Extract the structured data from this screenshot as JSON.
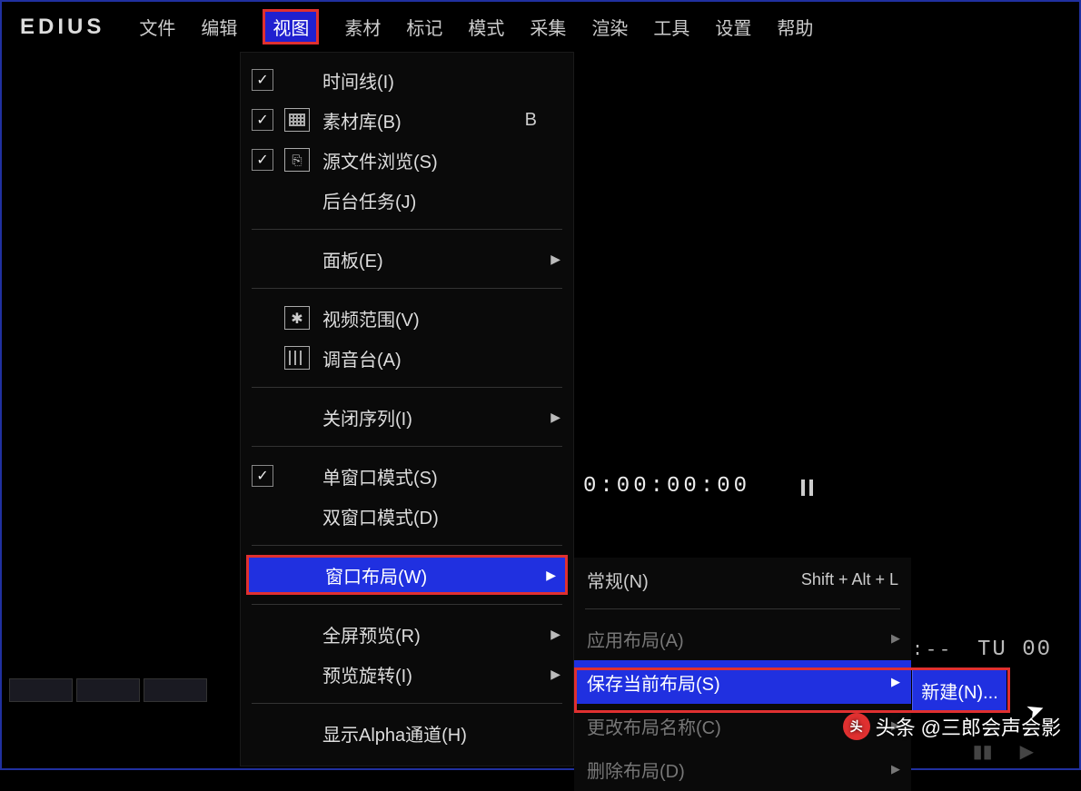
{
  "app": {
    "logo": "EDIUS"
  },
  "menubar": {
    "items": [
      "文件",
      "编辑",
      "视图",
      "素材",
      "标记",
      "模式",
      "采集",
      "渲染",
      "工具",
      "设置",
      "帮助"
    ],
    "active_index": 2
  },
  "dropdown": {
    "items": [
      {
        "checked": true,
        "icon": "",
        "label": "时间线(I)",
        "shortcut": "",
        "submenu": false
      },
      {
        "checked": true,
        "icon": "grid",
        "label": "素材库(B)",
        "shortcut": "B",
        "submenu": false
      },
      {
        "checked": true,
        "icon": "usb",
        "label": "源文件浏览(S)",
        "shortcut": "",
        "submenu": false
      },
      {
        "checked": false,
        "icon": "",
        "label": "后台任务(J)",
        "shortcut": "",
        "submenu": false
      },
      {
        "sep": true
      },
      {
        "checked": false,
        "icon": "",
        "label": "面板(E)",
        "shortcut": "",
        "submenu": true
      },
      {
        "sep": true
      },
      {
        "checked": false,
        "icon": "fan",
        "label": "视频范围(V)",
        "shortcut": "",
        "submenu": false
      },
      {
        "checked": false,
        "icon": "mixer",
        "label": "调音台(A)",
        "shortcut": "",
        "submenu": false
      },
      {
        "sep": true
      },
      {
        "checked": false,
        "icon": "",
        "label": "关闭序列(I)",
        "shortcut": "",
        "submenu": true
      },
      {
        "sep": true
      },
      {
        "checked": true,
        "icon": "",
        "label": "单窗口模式(S)",
        "shortcut": "",
        "submenu": false
      },
      {
        "checked": false,
        "icon": "",
        "label": "双窗口模式(D)",
        "shortcut": "",
        "submenu": false
      },
      {
        "sep": true
      },
      {
        "checked": false,
        "icon": "",
        "label": "窗口布局(W)",
        "shortcut": "",
        "submenu": true,
        "selected": true
      },
      {
        "sep": true
      },
      {
        "checked": false,
        "icon": "",
        "label": "全屏预览(R)",
        "shortcut": "",
        "submenu": true
      },
      {
        "checked": false,
        "icon": "",
        "label": "预览旋转(I)",
        "shortcut": "",
        "submenu": true
      },
      {
        "sep": true
      },
      {
        "checked": false,
        "icon": "",
        "label": "显示Alpha通道(H)",
        "shortcut": "",
        "submenu": false
      }
    ]
  },
  "submenu": {
    "items": [
      {
        "label": "常规(N)",
        "shortcut": "Shift + Alt + L",
        "submenu": false
      },
      {
        "sep": true
      },
      {
        "label": "应用布局(A)",
        "shortcut": "",
        "submenu": true,
        "dim": true
      },
      {
        "label": "保存当前布局(S)",
        "shortcut": "",
        "submenu": true,
        "selected": true
      },
      {
        "label": "更改布局名称(C)",
        "shortcut": "",
        "submenu": true,
        "dim": true
      },
      {
        "label": "删除布局(D)",
        "shortcut": "",
        "submenu": true,
        "dim": true
      }
    ]
  },
  "tertiary": {
    "label": "新建(N)..."
  },
  "preview": {
    "timecode": "0:00:00:00"
  },
  "timeline": {
    "tc_left": "--:--:--:--",
    "tc_right": "TU 00"
  },
  "watermark": {
    "prefix": "头条",
    "account": "@三郎会声会影"
  }
}
